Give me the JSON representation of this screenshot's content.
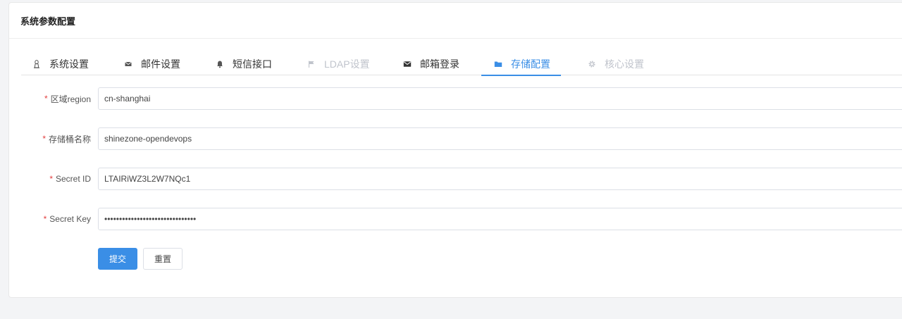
{
  "card": {
    "title": "系统参数配置"
  },
  "tabs": [
    {
      "label": "系统设置",
      "icon": "linux-icon",
      "state": "normal"
    },
    {
      "label": "邮件设置",
      "icon": "mail-icon",
      "state": "normal"
    },
    {
      "label": "短信接口",
      "icon": "bell-icon",
      "state": "normal"
    },
    {
      "label": "LDAP设置",
      "icon": "flag-icon",
      "state": "disabled"
    },
    {
      "label": "邮箱登录",
      "icon": "envelope-icon",
      "state": "normal"
    },
    {
      "label": "存储配置",
      "icon": "folder-icon",
      "state": "active"
    },
    {
      "label": "核心设置",
      "icon": "gear-icon",
      "state": "disabled"
    }
  ],
  "form": {
    "required_mark": "*",
    "region": {
      "label": "区域region",
      "value": "cn-shanghai"
    },
    "bucket": {
      "label": "存储桶名称",
      "value": "shinezone-opendevops"
    },
    "secret_id": {
      "label": "Secret ID",
      "value": "LTAIRiWZ3L2W7NQc1"
    },
    "secret_key": {
      "label": "Secret Key",
      "value": "abcdefghijklmnopqrstuvwxyz12345"
    },
    "submit_label": "提交",
    "reset_label": "重置"
  },
  "colors": {
    "accent": "#3a8ee6",
    "required": "#e23f3f",
    "disabled": "#c0c4cc"
  }
}
